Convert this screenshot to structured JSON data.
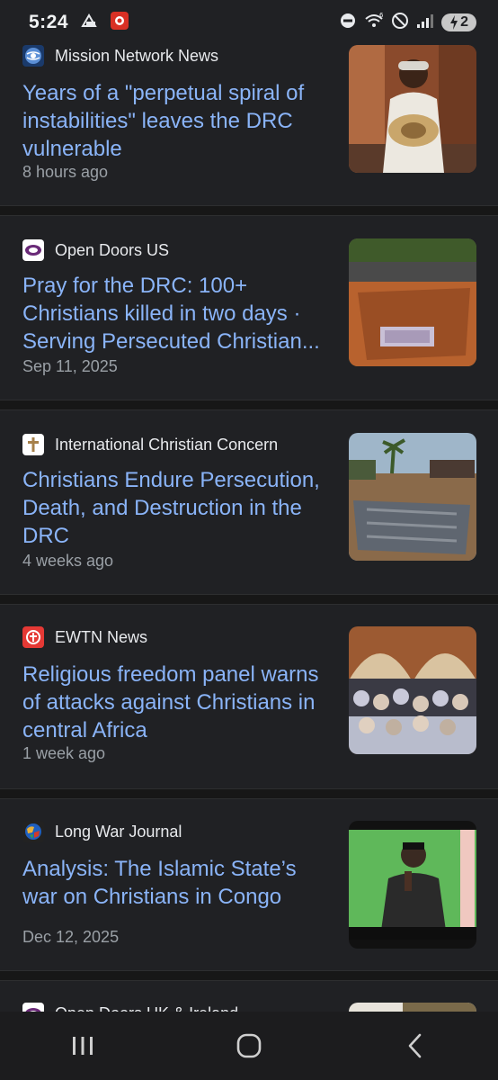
{
  "status_bar": {
    "time": "5:24",
    "battery_label": "2"
  },
  "articles": [
    {
      "source": "Mission Network News",
      "headline": "Years of a \"perpetual spiral of instabilities\" leaves the DRC vulnerable",
      "time": "8 hours ago",
      "favicon_icon": "globe-icon"
    },
    {
      "source": "Open Doors US",
      "headline": "Pray for the DRC: 100+ Christians killed in two days · Serving Persecuted Christian...",
      "time": "Sep 11, 2025",
      "favicon_icon": "open-doors-icon"
    },
    {
      "source": "International Christian Concern",
      "headline": "Christians Endure Persecution, Death, and Destruction in the DRC",
      "time": "4 weeks ago",
      "favicon_icon": "cross-icon"
    },
    {
      "source": "EWTN News",
      "headline": "Religious freedom panel warns of attacks against Christians in central Africa",
      "time": "1 week ago",
      "favicon_icon": "ewtn-icon"
    },
    {
      "source": "Long War Journal",
      "headline": "Analysis: The Islamic State’s war on Christians in Congo",
      "time": "Dec 12, 2025",
      "favicon_icon": "globe-color-icon"
    },
    {
      "source": "Open Doors UK & Ireland",
      "headline": "",
      "time": "",
      "favicon_icon": "open-doors-icon"
    }
  ],
  "colors": {
    "background": "#202124",
    "headline": "#8ab4f8",
    "source": "#e8eaed",
    "timestamp": "#9aa0a6"
  },
  "nav_bar": {
    "recents_icon": "recents-icon",
    "home_icon": "home-icon",
    "back_icon": "back-icon"
  }
}
